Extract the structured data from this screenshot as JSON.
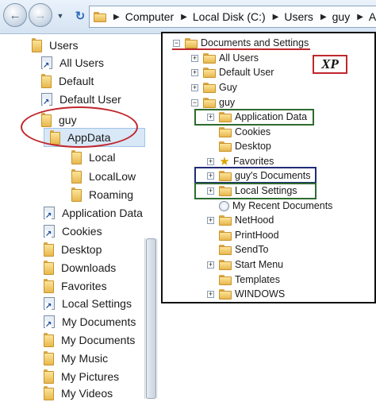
{
  "address_bar": {
    "crumbs": [
      "Computer",
      "Local Disk (C:)",
      "Users",
      "guy",
      "App"
    ]
  },
  "nav_pane": {
    "items": [
      {
        "label": "Users",
        "icon": "folder-icon"
      },
      {
        "label": "All Users",
        "icon": "shortcut-icon"
      },
      {
        "label": "Default",
        "icon": "folder-icon"
      },
      {
        "label": "Default User",
        "icon": "shortcut-icon"
      },
      {
        "label": "guy",
        "icon": "folder-icon"
      },
      {
        "label": "AppData",
        "icon": "folder-icon"
      },
      {
        "label": "Local",
        "icon": "folder-icon"
      },
      {
        "label": "LocalLow",
        "icon": "folder-icon"
      },
      {
        "label": "Roaming",
        "icon": "folder-icon"
      },
      {
        "label": "Application Data",
        "icon": "shortcut-icon"
      },
      {
        "label": "Cookies",
        "icon": "shortcut-icon"
      },
      {
        "label": "Desktop",
        "icon": "folder-icon"
      },
      {
        "label": "Downloads",
        "icon": "folder-icon"
      },
      {
        "label": "Favorites",
        "icon": "folder-icon"
      },
      {
        "label": "Local Settings",
        "icon": "shortcut-icon"
      },
      {
        "label": "My Documents",
        "icon": "shortcut-icon"
      },
      {
        "label": "My Documents",
        "icon": "folder-icon"
      },
      {
        "label": "My Music",
        "icon": "folder-icon"
      },
      {
        "label": "My Pictures",
        "icon": "folder-icon"
      },
      {
        "label": "My Videos",
        "icon": "folder-icon"
      }
    ]
  },
  "xp_tree": {
    "badge": "XP",
    "items": [
      {
        "label": "Documents and Settings",
        "expander": "−"
      },
      {
        "label": "All Users",
        "expander": "+"
      },
      {
        "label": "Default User",
        "expander": "+"
      },
      {
        "label": "Guy",
        "expander": "+"
      },
      {
        "label": "guy",
        "expander": "−"
      },
      {
        "label": "Application Data",
        "expander": "+"
      },
      {
        "label": "Cookies",
        "expander": ""
      },
      {
        "label": "Desktop",
        "expander": ""
      },
      {
        "label": "Favorites",
        "expander": "+"
      },
      {
        "label": "guy's Documents",
        "expander": "+"
      },
      {
        "label": "Local Settings",
        "expander": "+"
      },
      {
        "label": "My Recent Documents",
        "expander": ""
      },
      {
        "label": "NetHood",
        "expander": "+"
      },
      {
        "label": "PrintHood",
        "expander": ""
      },
      {
        "label": "SendTo",
        "expander": ""
      },
      {
        "label": "Start Menu",
        "expander": "+"
      },
      {
        "label": "Templates",
        "expander": ""
      },
      {
        "label": "WINDOWS",
        "expander": "+"
      }
    ]
  },
  "colors": {
    "highlight_red": "#c0272d",
    "box_green": "#2e6b2f",
    "box_navy": "#1f2b78"
  }
}
